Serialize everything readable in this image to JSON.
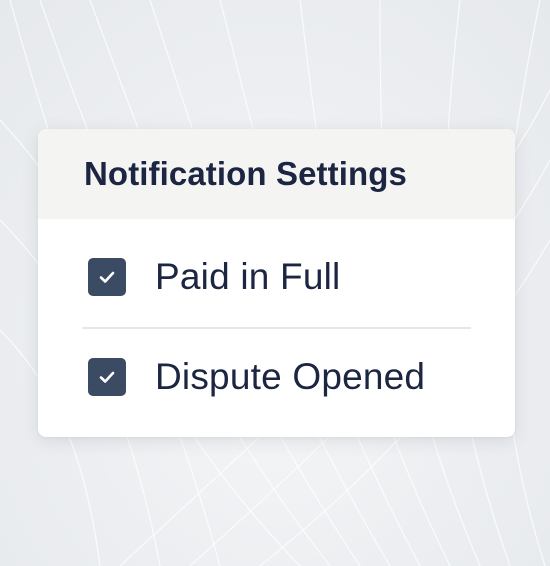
{
  "settings": {
    "title": "Notification Settings",
    "items": [
      {
        "label": "Paid in Full",
        "checked": true
      },
      {
        "label": "Dispute Opened",
        "checked": true
      }
    ]
  },
  "colors": {
    "title_text": "#1c2541",
    "checkbox_fill": "#3b4b63",
    "header_bg": "#f4f4f3",
    "page_bg": "#eef0f2"
  },
  "icons": {
    "checkbox": "checkmark-icon"
  }
}
